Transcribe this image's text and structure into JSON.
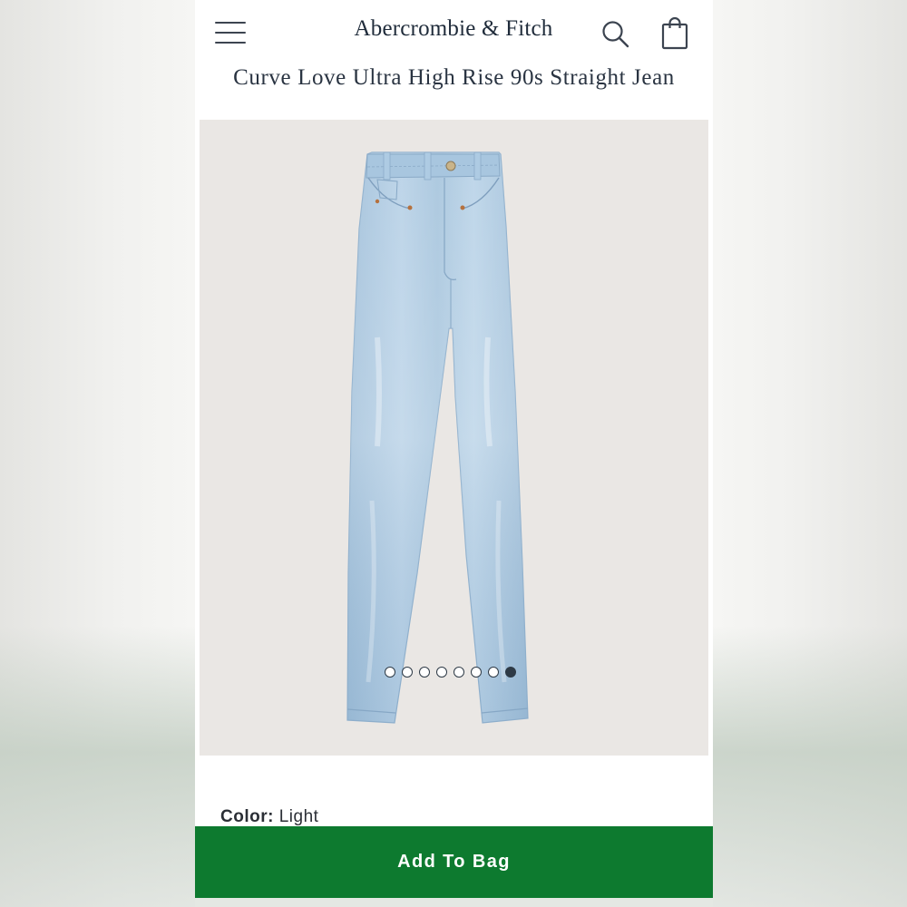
{
  "header": {
    "brand": "Abercrombie & Fitch",
    "menu_icon": "hamburger-menu-icon",
    "search_icon": "search-icon",
    "bag_icon": "shopping-bag-icon"
  },
  "product": {
    "title": "Curve Love Ultra High Rise 90s Straight Jean",
    "image_subject": "light wash straight leg jeans",
    "carousel": {
      "total_images": 8,
      "active_index": 8
    },
    "color_label": "Color:",
    "color_value": "Light"
  },
  "actions": {
    "add_to_bag_label": "Add To Bag"
  },
  "colors": {
    "accent_green": "#0d7a2f",
    "text_dark": "#1f2b3a",
    "image_background": "#eae7e4",
    "denim": "#a9c7df"
  }
}
